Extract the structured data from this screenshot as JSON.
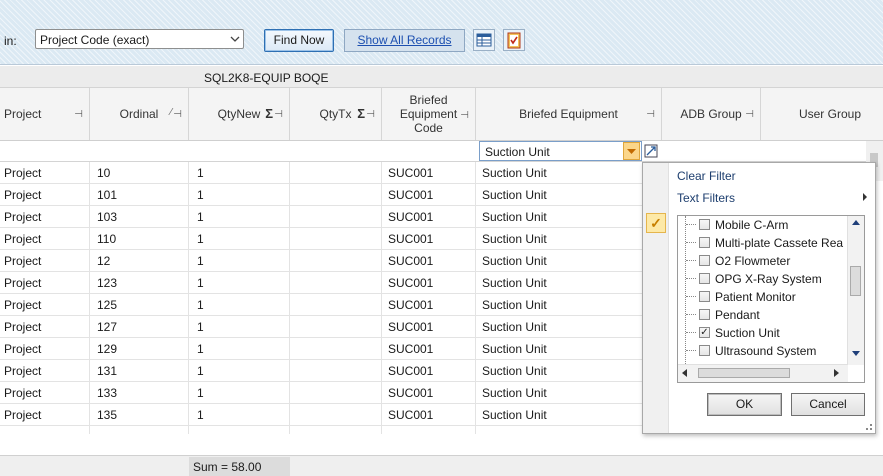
{
  "toolbar": {
    "search_in_label": "in:",
    "search_field": "Project Code (exact)",
    "find_now": "Find Now",
    "show_all": "Show All Records"
  },
  "group_title": "SQL2K8-EQUIP BOQE",
  "columns": {
    "project": "Project",
    "ordinal": "Ordinal",
    "qtynew": "QtyNew",
    "qtytx": "QtyTx",
    "briefed_code_1": "Briefed",
    "briefed_code_2": "Equipment",
    "briefed_code_3": "Code",
    "briefed_equipment": "Briefed Equipment",
    "adb_group": "ADB Group",
    "user_group": "User Group"
  },
  "filter_value": "Suction Unit",
  "rows": [
    {
      "project": "Project",
      "ordinal": "10",
      "qty": "1",
      "code": "SUC001",
      "equipment": "Suction Unit"
    },
    {
      "project": "Project",
      "ordinal": "101",
      "qty": "1",
      "code": "SUC001",
      "equipment": "Suction Unit"
    },
    {
      "project": "Project",
      "ordinal": "103",
      "qty": "1",
      "code": "SUC001",
      "equipment": "Suction Unit"
    },
    {
      "project": "Project",
      "ordinal": "110",
      "qty": "1",
      "code": "SUC001",
      "equipment": "Suction Unit"
    },
    {
      "project": "Project",
      "ordinal": "12",
      "qty": "1",
      "code": "SUC001",
      "equipment": "Suction Unit"
    },
    {
      "project": "Project",
      "ordinal": "123",
      "qty": "1",
      "code": "SUC001",
      "equipment": "Suction Unit"
    },
    {
      "project": "Project",
      "ordinal": "125",
      "qty": "1",
      "code": "SUC001",
      "equipment": "Suction Unit"
    },
    {
      "project": "Project",
      "ordinal": "127",
      "qty": "1",
      "code": "SUC001",
      "equipment": "Suction Unit"
    },
    {
      "project": "Project",
      "ordinal": "129",
      "qty": "1",
      "code": "SUC001",
      "equipment": "Suction Unit"
    },
    {
      "project": "Project",
      "ordinal": "131",
      "qty": "1",
      "code": "SUC001",
      "equipment": "Suction Unit"
    },
    {
      "project": "Project",
      "ordinal": "133",
      "qty": "1",
      "code": "SUC001",
      "equipment": "Suction Unit"
    },
    {
      "project": "Project",
      "ordinal": "135",
      "qty": "1",
      "code": "SUC001",
      "equipment": "Suction Unit"
    }
  ],
  "footer": {
    "sum": "Sum = 58.00"
  },
  "popup": {
    "clear_filter": "Clear Filter",
    "text_filters": "Text Filters",
    "items": [
      {
        "label": "Mobile C-Arm",
        "checked": false
      },
      {
        "label": "Multi-plate Cassete Rea",
        "checked": false
      },
      {
        "label": "O2 Flowmeter",
        "checked": false
      },
      {
        "label": "OPG X-Ray System",
        "checked": false
      },
      {
        "label": "Patient Monitor",
        "checked": false
      },
      {
        "label": "Pendant",
        "checked": false
      },
      {
        "label": "Suction Unit",
        "checked": true
      },
      {
        "label": "Ultrasound System",
        "checked": false
      }
    ],
    "ok": "OK",
    "cancel": "Cancel"
  }
}
